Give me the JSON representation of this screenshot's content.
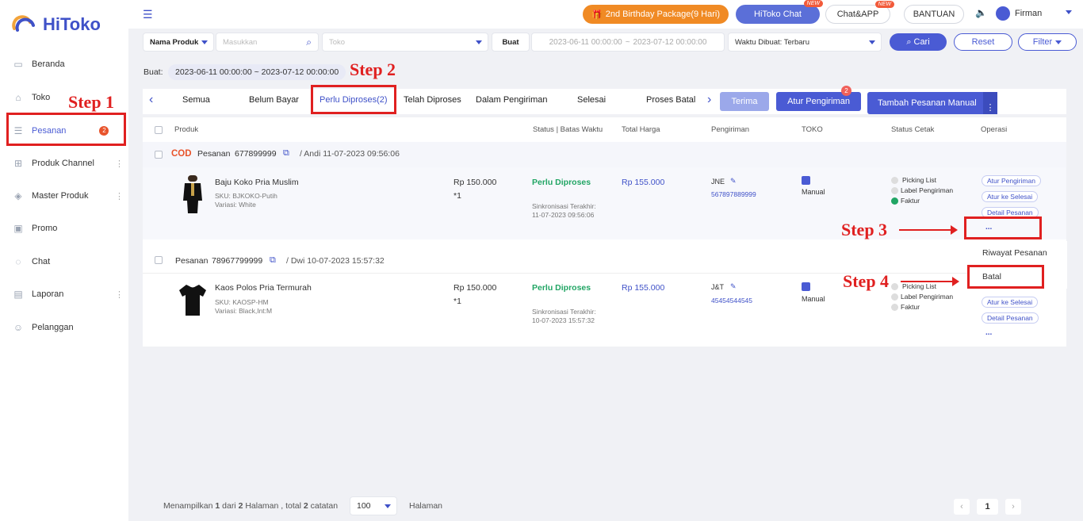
{
  "brand": {
    "name": "HiToko",
    "accent": "#3f51c8"
  },
  "sidebar": {
    "items": [
      {
        "label": "Beranda",
        "icon": "monitor-icon"
      },
      {
        "label": "Toko",
        "icon": "store-icon"
      },
      {
        "label": "Pesanan",
        "icon": "orders-icon",
        "badge": "2"
      },
      {
        "label": "Produk Channel",
        "icon": "grid-icon"
      },
      {
        "label": "Master Produk",
        "icon": "box-icon"
      },
      {
        "label": "Promo",
        "icon": "promo-icon"
      },
      {
        "label": "Chat",
        "icon": "chat-icon"
      },
      {
        "label": "Laporan",
        "icon": "report-icon"
      },
      {
        "label": "Pelanggan",
        "icon": "users-icon"
      }
    ]
  },
  "topbar": {
    "birthday": "2nd Birthday Package(9 Hari)",
    "hitoko_chat": "HiToko Chat",
    "chat_app": "Chat&APP",
    "new_tag": "NEW",
    "bantuan": "BANTUAN",
    "user": "Firman"
  },
  "filters": {
    "field_select": "Nama Produk",
    "search_placeholder": "Masukkan",
    "toko_placeholder": "Toko",
    "date_label": "Buat",
    "date_start": "2023-06-11 00:00:00",
    "date_sep": "~",
    "date_end": "2023-07-12 00:00:00",
    "sort": "Waktu Dibuat: Terbaru",
    "search_button": "Cari",
    "reset_button": "Reset",
    "filter_button": "Filter"
  },
  "chip": {
    "label": "Buat:",
    "value": "2023-06-11 00:00:00 ~ 2023-07-12 00:00:00"
  },
  "tabs": [
    {
      "label": "Semua"
    },
    {
      "label": "Belum Bayar"
    },
    {
      "label": "Perlu Diproses(2)"
    },
    {
      "label": "Telah Diproses"
    },
    {
      "label": "Dalam Pengiriman"
    },
    {
      "label": "Selesai"
    },
    {
      "label": "Proses Batal"
    }
  ],
  "actions": {
    "terima": "Terima",
    "atur": "Atur Pengiriman",
    "atur_badge": "2",
    "tambah": "Tambah Pesanan Manual"
  },
  "columns": {
    "produk": "Produk",
    "status": "Status | Batas Waktu",
    "total": "Total Harga",
    "pengiriman": "Pengiriman",
    "toko": "TOKO",
    "cetak": "Status Cetak",
    "operasi": "Operasi"
  },
  "orders": [
    {
      "cod": "COD",
      "order_label": "Pesanan",
      "order_no": "677899999",
      "meta": "/ Andi  11-07-2023 09:56:06",
      "product": "Baju Koko Pria Muslim",
      "sku": "SKU:  BJKOKO-Putih",
      "variasi": "Variasi:  White",
      "price": "Rp 150.000",
      "qty": "*1",
      "status": "Perlu Diproses",
      "sync_label": "Sinkronisasi Terakhir:",
      "sync_time": "11-07-2023 09:56:06",
      "total": "Rp 155.000",
      "courier": "JNE",
      "resi": "567897889999",
      "toko": "Manual",
      "cetak": [
        "Picking List",
        "Label Pengiriman",
        "Faktur"
      ],
      "ops": [
        "Atur Pengiriman",
        "Atur ke Selesai",
        "Detail Pesanan"
      ],
      "more": "..."
    },
    {
      "order_label": "Pesanan",
      "order_no": "78967799999",
      "meta": "/ Dwi  10-07-2023 15:57:32",
      "product": "Kaos Polos Pria Termurah",
      "sku": "SKU:  KAOSP-HM",
      "variasi": "Variasi:  Black,Int:M",
      "price": "Rp 150.000",
      "qty": "*1",
      "status": "Perlu Diproses",
      "sync_label": "Sinkronisasi Terakhir:",
      "sync_time": "10-07-2023 15:57:32",
      "total": "Rp 155.000",
      "courier": "J&T",
      "resi": "45454544545",
      "toko": "Manual",
      "cetak": [
        "Picking List",
        "Label Pengiriman",
        "Faktur"
      ],
      "ops": [
        "Atur ke Selesai",
        "Detail Pesanan"
      ],
      "more": "..."
    }
  ],
  "dropdown": {
    "items": [
      "Riwayat Pesanan",
      "Batal"
    ]
  },
  "steps": [
    "Step 1",
    "Step 2",
    "Step 3",
    "Step 4"
  ],
  "footer": {
    "text_a": "Menampilkan ",
    "page": "1",
    "text_b": " dari ",
    "pages": "2",
    "text_c": " Halaman , total ",
    "total": "2",
    "text_d": " catatan",
    "page_size": "100",
    "halaman": "Halaman",
    "current_page": "1"
  }
}
